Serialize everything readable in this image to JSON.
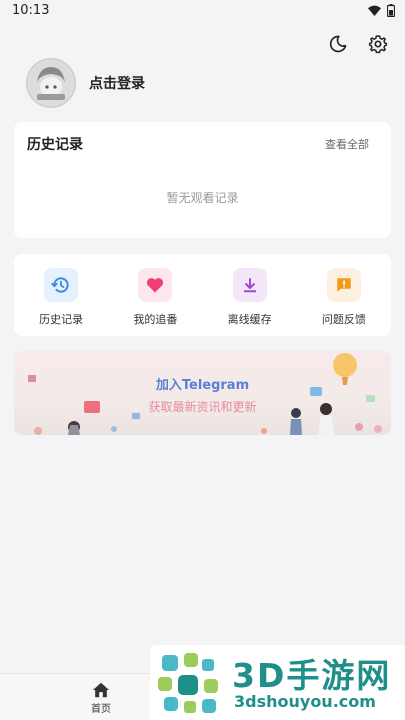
{
  "status_bar": {
    "time": "10:13"
  },
  "profile": {
    "login_label": "点击登录"
  },
  "history": {
    "title": "历史记录",
    "view_all": "查看全部",
    "empty_text": "暂无观看记录"
  },
  "menu": [
    {
      "label": "历史记录",
      "icon": "history-icon",
      "bg": "#e6f1fd",
      "color": "#3d8be6"
    },
    {
      "label": "我的追番",
      "icon": "heart-icon",
      "bg": "#fde6ee",
      "color": "#ee3f74"
    },
    {
      "label": "离线缓存",
      "icon": "download-icon",
      "bg": "#f2e6f8",
      "color": "#9c4ac9"
    },
    {
      "label": "问题反馈",
      "icon": "feedback-icon",
      "bg": "#fdf0e0",
      "color": "#f39a1d"
    }
  ],
  "banner": {
    "title": "加入Telegram",
    "subtitle": "获取最新资讯和更新"
  },
  "tabbar": {
    "home_label": "首页"
  },
  "watermark": {
    "brand": "3D手游网",
    "url": "3dshouyou.com"
  }
}
